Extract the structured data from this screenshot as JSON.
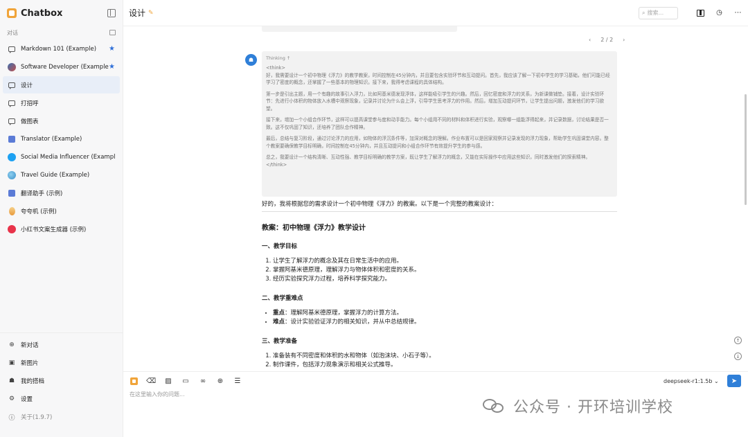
{
  "app": {
    "name": "Chatbox",
    "accent": "#2f7fd8",
    "brand_color": "#f0a43a"
  },
  "sidebar": {
    "section_label": "对话",
    "items": [
      {
        "label": "Markdown 101 (Example)",
        "icon": "chat-icon",
        "starred": true
      },
      {
        "label": "Software Developer (Example)",
        "icon": "avatar-icon",
        "starred": true
      },
      {
        "label": "设计",
        "icon": "chat-icon",
        "active": true
      },
      {
        "label": "打招呼",
        "icon": "chat-icon"
      },
      {
        "label": "做图表",
        "icon": "chat-icon"
      },
      {
        "label": "Translator (Example)",
        "icon": "avatar-icon"
      },
      {
        "label": "Social Media Influencer (Example)",
        "icon": "twitter-icon"
      },
      {
        "label": "Travel Guide (Example)",
        "icon": "globe-icon"
      },
      {
        "label": "翻译助手 (示例)",
        "icon": "avatar-icon"
      },
      {
        "label": "夸夸机 (示例)",
        "icon": "avatar-icon"
      },
      {
        "label": "小红书文案生成器 (示例)",
        "icon": "xiaohongshu-icon"
      }
    ],
    "bottom": {
      "new_chat": "新对话",
      "new_image": "新图片",
      "my_partners": "我的搭档",
      "settings": "设置",
      "about": "关于(1.9.7)"
    }
  },
  "header": {
    "title": "设计",
    "search_placeholder": "搜索..."
  },
  "message": {
    "pager": "2 / 2",
    "thinking_label": "Thinking",
    "thinking_paragraphs": [
      "<think>\n好，我需要设计一个初中物理《浮力》的教学教案，时间控制在45分钟内，并且要包含实验环节和互动提问。首先，我应该了解一下初中学生的学习基础，他们可能已经学习了密度的概念，还掌握了一些基本的物理知识。接下来，我得考虑课程的具体结构。",
      "第一步是引出主题，用一个有趣的故事引入浮力，比如阿基米德发现浮体，这样能吸引学生的兴趣。然后，回忆密度和浮力的关系，为新课做铺垫。接着，设计实验环节：先进行小体积的物体放入水槽中观察现象，记录并讨论为什么会上浮，引导学生思考浮力的作用。然后，增加互动提问环节，让学生提出问题，激发他们的学习欲望。",
      "接下来，增加一个小组合作环节，这样可以提高课堂参与度和动手能力。每个小组用不同的材料和体积进行实验，观察哪一组能浮得起来，并记录数据，讨论结果是否一致。这不仅巩固了知识，还培养了团队合作精神。",
      "最后，总结与复习阶段，通过讨论浮力的应用，如物体的浮沉条件等，加深对概念的理解。作业布置可以是回家观察并记录发现的浮力现象，帮助学生巩固课堂内容。整个教案要确保教学目标明确，时间控制在45分钟内，并且互动提问和小组合作环节有效提升学生的参与感。",
      "总之，我要设计一个结构清晰、互动性强、教学目标明确的教学方案，既让学生了解浮力的概念，又能在实际操作中应用这些知识，同时激发他们的探索精神。\n</think>"
    ],
    "intro": "好的，我将根据您的需求设计一个初中物理《浮力》的教案。以下是一个完整的教案设计：",
    "doc_title": "教案：初中物理《浮力》教学设计",
    "sec1_title": "一、教学目标",
    "sec1_items": [
      "让学生了解浮力的概念及其在日常生活中的应用。",
      "掌握阿基米德原理，理解浮力与物体体积和密度的关系。",
      "经历实验探究浮力过程，培养科学探究能力。"
    ],
    "sec2_title": "二、教学重难点",
    "sec2_items": [
      {
        "term": "重点",
        "text": "：理解阿基米德原理，掌握浮力的计算方法。"
      },
      {
        "term": "难点",
        "text": "：设计实验验证浮力的相关知识，并从中总结规律。"
      }
    ],
    "sec3_title": "三、教学准备",
    "sec3_items": [
      "准备装有不同密度和体积的水和物体（如泡沫块、小石子等）。",
      "制作课件，包括浮力现象演示和相关公式推导。"
    ]
  },
  "composer": {
    "placeholder": "在这里输入你的问题...",
    "model": "deepseek-r1:1.5b"
  },
  "watermark": "公众号 · 开环培训学校"
}
